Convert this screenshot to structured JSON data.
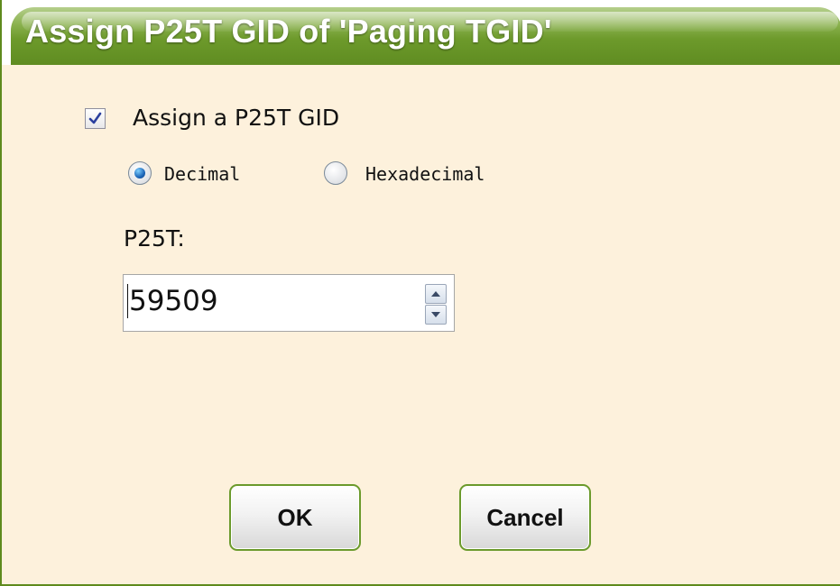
{
  "dialog": {
    "title": "Assign P25T GID of 'Paging TGID'",
    "assign_checkbox": {
      "label": "Assign a P25T GID",
      "checked": true
    },
    "format": {
      "options": [
        "Decimal",
        "Hexadecimal"
      ],
      "selected": "Decimal"
    },
    "field_label": "P25T:",
    "field_value": "59509",
    "ok_label": "OK",
    "cancel_label": "Cancel"
  },
  "colors": {
    "title_bar": "#6d9a2b",
    "dialog_background": "#fdf1dc",
    "button_border": "#6b9a2c",
    "radio_selected": "#1c66b8"
  }
}
